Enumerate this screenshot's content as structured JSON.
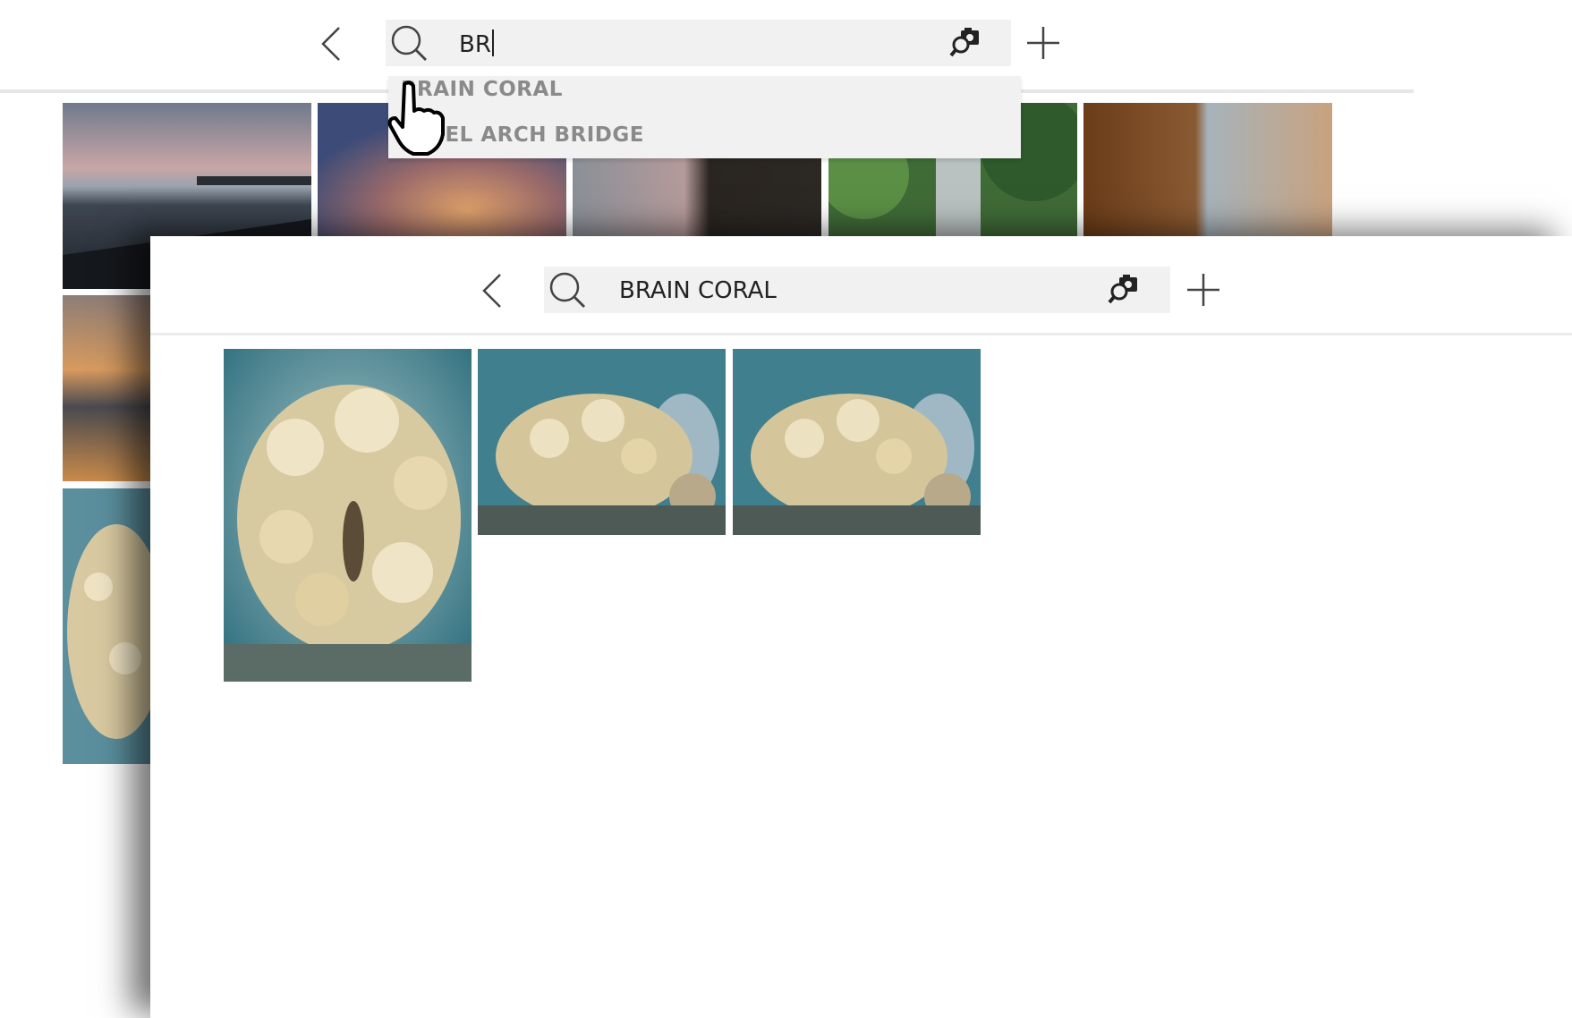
{
  "back_window": {
    "search": {
      "value": "BR"
    },
    "suggestions": [
      "BRAIN CORAL",
      "STEEL ARCH BRIDGE"
    ],
    "visible_suggestions": [
      "BRAIN CORAL",
      "EL ARCH BRIDGE"
    ],
    "icons": {
      "back": "chevron-left-icon",
      "search": "search-icon",
      "image_search": "camera-search-icon",
      "add": "plus-icon",
      "cursor": "hand-pointer-icon"
    },
    "thumbnails": [
      "coast-sunset-photo",
      "orange-clouds-photo",
      "dusk-sea-photo",
      "waterfall-forest-photo",
      "rocky-shore-photo",
      "orange-sunset-photo",
      "coral-photo"
    ]
  },
  "front_window": {
    "search": {
      "value": "BRAIN CORAL"
    },
    "icons": {
      "back": "chevron-left-icon",
      "search": "search-icon",
      "image_search": "camera-search-icon",
      "add": "plus-icon"
    },
    "results": [
      "brain-coral-photo-1",
      "brain-coral-photo-2",
      "brain-coral-photo-3"
    ]
  },
  "colors": {
    "searchbar_bg": "#f1f1f1",
    "suggestion_text": "#8a8a8a",
    "text": "#222222"
  }
}
